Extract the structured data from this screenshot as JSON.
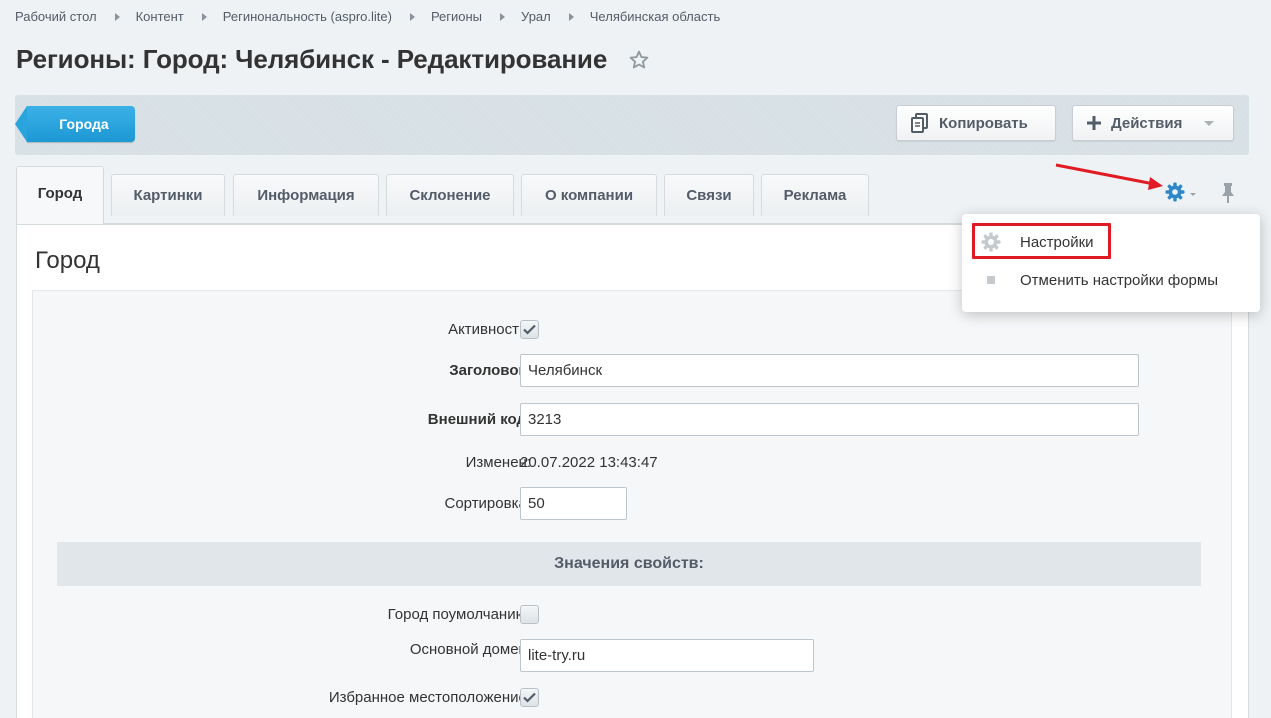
{
  "breadcrumb": [
    "Рабочий стол",
    "Контент",
    "Регинональность (aspro.lite)",
    "Регионы",
    "Урал",
    "Челябинская область"
  ],
  "page_title": "Регионы: Город: Челябинск - Редактирование",
  "toolbar": {
    "back_label": "Города",
    "copy_label": "Копировать",
    "actions_label": "Действия"
  },
  "tabs": [
    {
      "label": "Город",
      "active": true
    },
    {
      "label": "Картинки"
    },
    {
      "label": "Информация"
    },
    {
      "label": "Склонение"
    },
    {
      "label": "О компании"
    },
    {
      "label": "Связи"
    },
    {
      "label": "Реклама"
    }
  ],
  "settings_menu": {
    "items": [
      {
        "label": "Настройки",
        "icon": "gear-icon"
      },
      {
        "label": "Отменить настройки формы",
        "icon": "bullet-icon"
      }
    ]
  },
  "form": {
    "section_title": "Город",
    "active_label": "Активность:",
    "active_checked": true,
    "title_label": "Заголовок:",
    "title_value": "Челябинск",
    "external_code_label": "Внешний код:",
    "external_code_value": "3213",
    "modified_label": "Изменен:",
    "modified_value": "20.07.2022 13:43:47",
    "sort_label": "Сортировка:",
    "sort_value": "50",
    "properties_header": "Значения свойств:",
    "default_city_label": "Город поумолчанию:",
    "default_city_checked": false,
    "main_domain_label": "Основной домен:",
    "main_domain_value": "lite-try.ru",
    "favorite_location_label": "Избранное местоположение:",
    "favorite_location_checked": true
  },
  "colors": {
    "accent_blue": "#1c98d4",
    "highlight_red": "#e01b24",
    "gear_blue": "#2d87c8"
  }
}
